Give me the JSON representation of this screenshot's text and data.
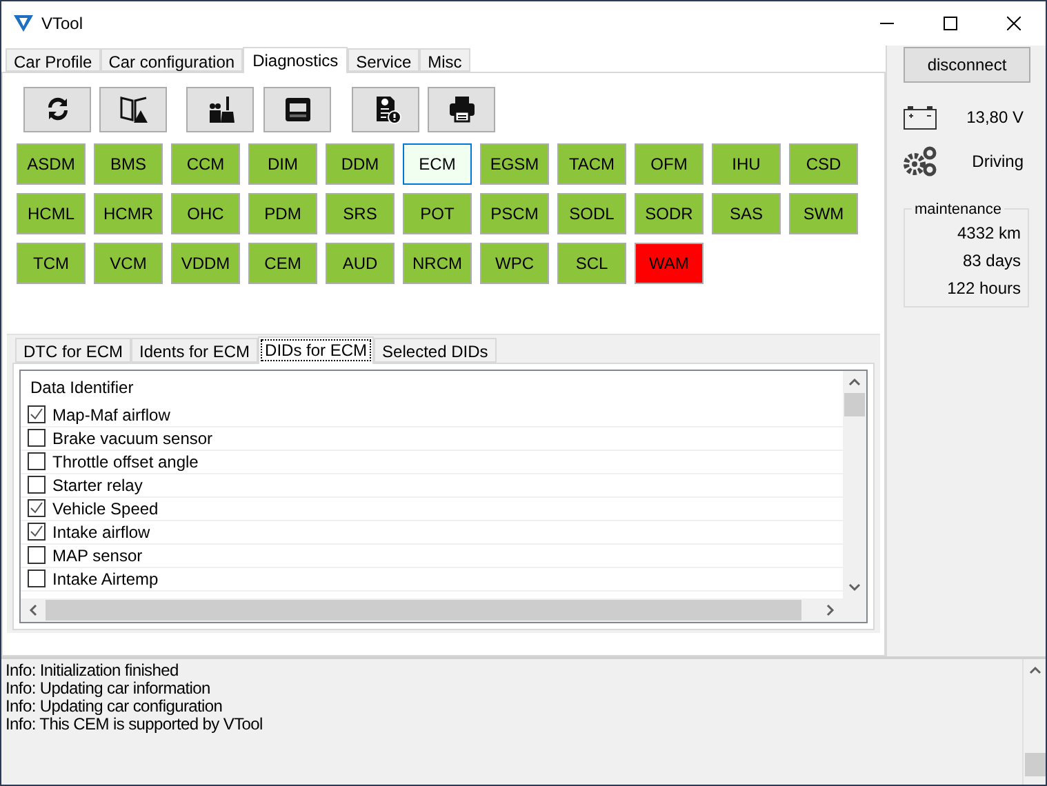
{
  "window": {
    "title": "VTool"
  },
  "tabs": [
    {
      "label": "Car Profile",
      "selected": false
    },
    {
      "label": "Car configuration",
      "selected": false
    },
    {
      "label": "Diagnostics",
      "selected": true
    },
    {
      "label": "Service",
      "selected": false
    },
    {
      "label": "Misc",
      "selected": false
    }
  ],
  "toolbar": [
    {
      "kind": "refresh"
    },
    {
      "kind": "manual"
    },
    {
      "kind": "clean"
    },
    {
      "kind": "display"
    },
    {
      "kind": "report"
    },
    {
      "kind": "print"
    }
  ],
  "modules": [
    {
      "label": "ASDM",
      "selected": false,
      "color": "#8cc43c"
    },
    {
      "label": "BMS",
      "selected": false,
      "color": "#8cc43c"
    },
    {
      "label": "CCM",
      "selected": false,
      "color": "#8cc43c"
    },
    {
      "label": "DIM",
      "selected": false,
      "color": "#8cc43c"
    },
    {
      "label": "DDM",
      "selected": false,
      "color": "#8cc43c"
    },
    {
      "label": "ECM",
      "selected": true,
      "color": "#f0fff0"
    },
    {
      "label": "EGSM",
      "selected": false,
      "color": "#8cc43c"
    },
    {
      "label": "TACM",
      "selected": false,
      "color": "#8cc43c"
    },
    {
      "label": "OFM",
      "selected": false,
      "color": "#8cc43c"
    },
    {
      "label": "IHU",
      "selected": false,
      "color": "#8cc43c"
    },
    {
      "label": "CSD",
      "selected": false,
      "color": "#8cc43c"
    },
    {
      "label": "HCML",
      "selected": false,
      "color": "#8cc43c"
    },
    {
      "label": "HCMR",
      "selected": false,
      "color": "#8cc43c"
    },
    {
      "label": "OHC",
      "selected": false,
      "color": "#8cc43c"
    },
    {
      "label": "PDM",
      "selected": false,
      "color": "#8cc43c"
    },
    {
      "label": "SRS",
      "selected": false,
      "color": "#8cc43c"
    },
    {
      "label": "POT",
      "selected": false,
      "color": "#8cc43c"
    },
    {
      "label": "PSCM",
      "selected": false,
      "color": "#8cc43c"
    },
    {
      "label": "SODL",
      "selected": false,
      "color": "#8cc43c"
    },
    {
      "label": "SODR",
      "selected": false,
      "color": "#8cc43c"
    },
    {
      "label": "SAS",
      "selected": false,
      "color": "#8cc43c"
    },
    {
      "label": "SWM",
      "selected": false,
      "color": "#8cc43c"
    },
    {
      "label": "TCM",
      "selected": false,
      "color": "#8cc43c"
    },
    {
      "label": "VCM",
      "selected": false,
      "color": "#8cc43c"
    },
    {
      "label": "VDDM",
      "selected": false,
      "color": "#8cc43c"
    },
    {
      "label": "CEM",
      "selected": false,
      "color": "#8cc43c"
    },
    {
      "label": "AUD",
      "selected": false,
      "color": "#8cc43c"
    },
    {
      "label": "NRCM",
      "selected": false,
      "color": "#8cc43c"
    },
    {
      "label": "WPC",
      "selected": false,
      "color": "#8cc43c"
    },
    {
      "label": "SCL",
      "selected": false,
      "color": "#8cc43c"
    },
    {
      "label": "WAM",
      "selected": false,
      "color": "#ff0000"
    }
  ],
  "subtabs": [
    {
      "label": "DTC for ECM",
      "selected": false
    },
    {
      "label": "Idents for ECM",
      "selected": false
    },
    {
      "label": "DIDs for ECM",
      "selected": true
    },
    {
      "label": "Selected DIDs",
      "selected": false
    }
  ],
  "did_list": {
    "header": "Data Identifier",
    "rows": [
      {
        "label": "Map-Maf airflow",
        "checked": true
      },
      {
        "label": "Brake vacuum sensor",
        "checked": false
      },
      {
        "label": "Throttle offset angle",
        "checked": false
      },
      {
        "label": "Starter relay",
        "checked": false
      },
      {
        "label": "Vehicle Speed",
        "checked": true
      },
      {
        "label": "Intake airflow",
        "checked": true
      },
      {
        "label": "MAP sensor",
        "checked": false
      },
      {
        "label": "Intake Airtemp",
        "checked": false
      }
    ]
  },
  "side": {
    "disconnect": "disconnect",
    "voltage": "13,80 V",
    "state": "Driving",
    "maintenance": {
      "title": "maintenance",
      "values": [
        "4332 km",
        "83 days",
        "122 hours"
      ]
    }
  },
  "log": [
    "Info: Initialization finished",
    "Info: Updating car information",
    "Info: Updating car configuration",
    "Info: This CEM is supported by VTool"
  ]
}
